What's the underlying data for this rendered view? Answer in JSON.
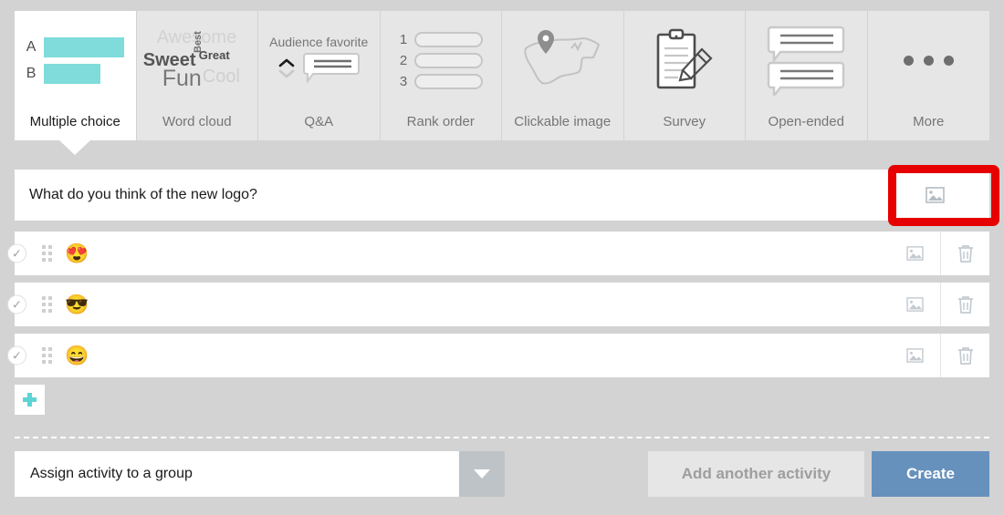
{
  "tabs": [
    {
      "id": "multiple-choice",
      "label": "Multiple choice",
      "active": true,
      "art": "bars",
      "bars": [
        {
          "letter": "A",
          "len": 88
        },
        {
          "letter": "B",
          "len": 62
        }
      ],
      "bar_color": "#80dbdb"
    },
    {
      "id": "word-cloud",
      "label": "Word cloud",
      "active": false,
      "art": "wordcloud",
      "words": [
        "Awesome",
        "Sweet",
        "Best",
        "Great",
        "Fun",
        "Cool"
      ]
    },
    {
      "id": "qa",
      "label": "Q&A",
      "active": false,
      "art": "qa",
      "caption": "Audience favorite"
    },
    {
      "id": "rank-order",
      "label": "Rank order",
      "active": false,
      "art": "rank",
      "numbers": [
        "1",
        "2",
        "3"
      ]
    },
    {
      "id": "clickable-image",
      "label": "Clickable image",
      "active": false,
      "art": "map-pin"
    },
    {
      "id": "survey",
      "label": "Survey",
      "active": false,
      "art": "clipboard-pencil"
    },
    {
      "id": "open-ended",
      "label": "Open-ended",
      "active": false,
      "art": "speech-bubbles"
    },
    {
      "id": "more",
      "label": "More",
      "active": false,
      "art": "ellipsis"
    }
  ],
  "question": {
    "text": "What do you think of the new logo?",
    "image_icon": "image-icon",
    "highlight_color": "#e60000"
  },
  "options": [
    {
      "emoji": "😍",
      "check": "✓",
      "image_icon": "image-icon",
      "trash_icon": "trash-icon"
    },
    {
      "emoji": "😎",
      "check": "✓",
      "image_icon": "image-icon",
      "trash_icon": "trash-icon"
    },
    {
      "emoji": "😄",
      "check": "✓",
      "image_icon": "image-icon",
      "trash_icon": "trash-icon"
    }
  ],
  "add_option": {
    "icon": "plus-icon",
    "color": "#5fd4d4"
  },
  "footer": {
    "assign": {
      "text": "Assign activity to a group",
      "caret": "chevron-down-icon"
    },
    "add_another_label": "Add another activity",
    "create_label": "Create",
    "create_color": "#6691bd"
  }
}
